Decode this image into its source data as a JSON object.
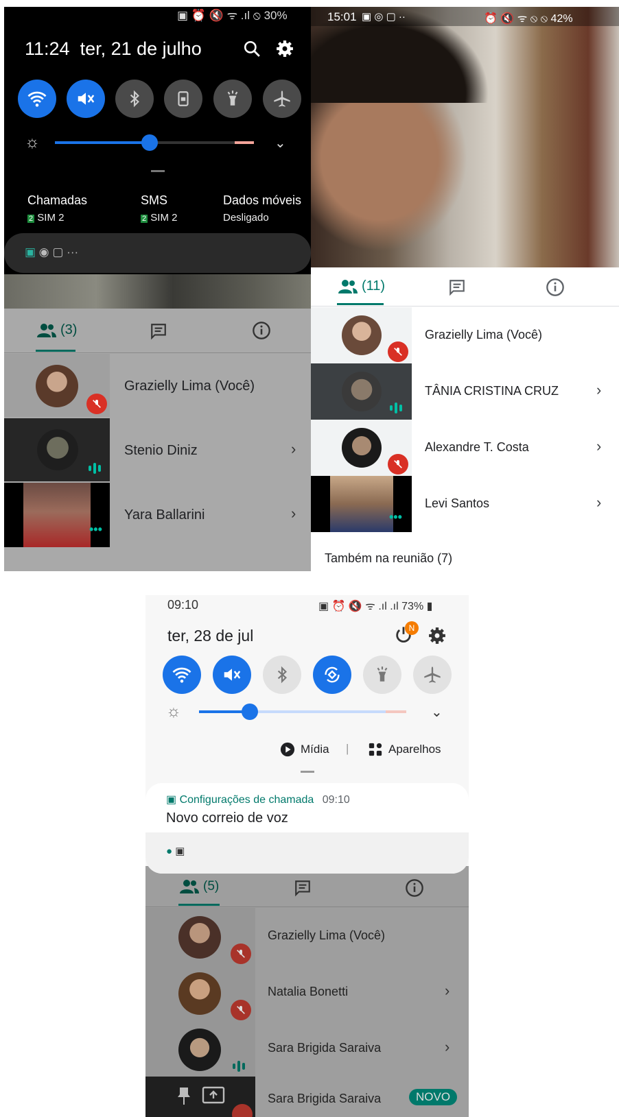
{
  "p1": {
    "status": {
      "battery": "30%"
    },
    "header": {
      "time": "11:24",
      "date": "ter, 21 de julho"
    },
    "sims": [
      {
        "label": "Chamadas",
        "badge": "2",
        "value": "SIM 2"
      },
      {
        "label": "SMS",
        "badge": "2",
        "value": "SIM 2"
      },
      {
        "label": "Dados móveis",
        "badge": "",
        "value": "Desligado"
      }
    ],
    "tabs": {
      "people": "(3)"
    },
    "participants": [
      {
        "name": "Grazielly Lima (Você)"
      },
      {
        "name": "Stenio Diniz"
      },
      {
        "name": "Yara Ballarini"
      }
    ]
  },
  "p2": {
    "status": {
      "time": "15:01",
      "battery": "42%"
    },
    "tabs": {
      "people": "(11)"
    },
    "participants": [
      {
        "name": "Grazielly Lima (Você)"
      },
      {
        "name": "TÂNIA CRISTINA CRUZ"
      },
      {
        "name": "Alexandre T. Costa"
      },
      {
        "name": "Levi Santos"
      }
    ],
    "also": "Também na reunião (7)"
  },
  "p3": {
    "status": {
      "time": "09:10",
      "battery": "73%"
    },
    "header": {
      "date": "ter, 28 de jul",
      "badge": "N"
    },
    "media": {
      "midia": "Mídia",
      "separator": "|",
      "aparelhos": "Aparelhos"
    },
    "notif": {
      "app": "Configurações de chamada",
      "time": "09:10",
      "text": "Novo correio de voz"
    },
    "tabs": {
      "people": "(5)"
    },
    "participants": [
      {
        "name": "Grazielly Lima (Você)"
      },
      {
        "name": "Natalia Bonetti"
      },
      {
        "name": "Sara Brigida Saraiva"
      },
      {
        "name": "Sara Brigida Saraiva",
        "badge": "NOVO"
      }
    ]
  },
  "colors": {
    "accent": "#1a73e8",
    "teal": "#00796b",
    "mute": "#d93025"
  }
}
